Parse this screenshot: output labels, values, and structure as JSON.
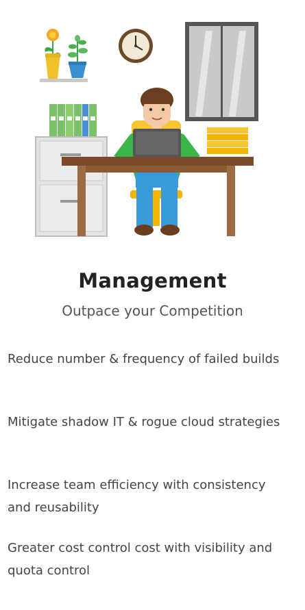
{
  "card": {
    "title": "Management",
    "subtitle": "Outpace your Competition",
    "benefits": [
      "Reduce number & frequency of failed builds",
      "Mitigate shadow IT & rogue cloud strategies",
      "Increase team efficiency with consistency and reusability",
      "Greater cost control cost with visibility and quota control"
    ]
  },
  "illustration": {
    "icon": "office-worker-illustration",
    "colors": {
      "shirt": "#39b54a",
      "pants": "#3a9ad9",
      "chair": "#f7c531",
      "desk": "#7a4a2a",
      "binders": "#7cc16a",
      "cabinet": "#e0e0e0",
      "clock_rim": "#6b4a2a",
      "window_frame": "#555555"
    }
  }
}
